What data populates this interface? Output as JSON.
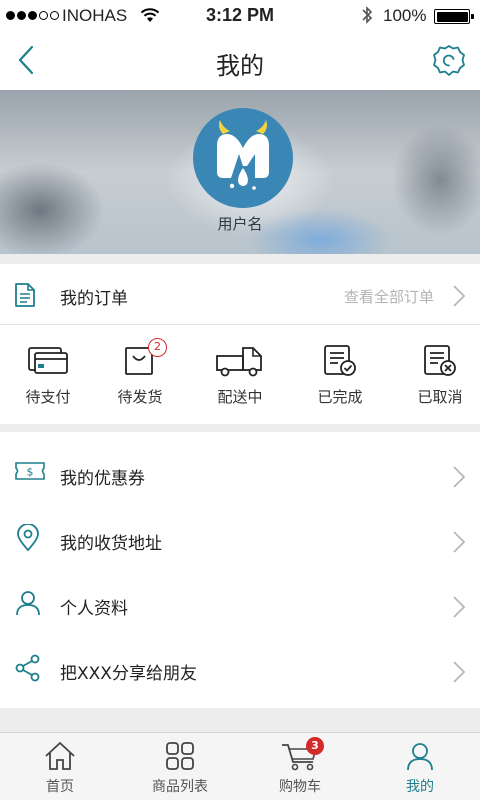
{
  "status_bar": {
    "carrier": "INOHAS",
    "time": "3:12 PM",
    "battery": "100%",
    "battery_level": 1.0
  },
  "nav": {
    "title": "我的",
    "back_icon": "chevron-left-icon",
    "settings_icon": "gear-icon"
  },
  "profile": {
    "username": "用户名"
  },
  "orders": {
    "title": "我的订单",
    "view_all": "查看全部订单",
    "statuses": [
      {
        "label": "待支付",
        "icon": "card-icon"
      },
      {
        "label": "待发货",
        "icon": "bag-icon",
        "badge": "2"
      },
      {
        "label": "配送中",
        "icon": "truck-icon"
      },
      {
        "label": "已完成",
        "icon": "doc-check-icon"
      },
      {
        "label": "已取消",
        "icon": "doc-cancel-icon"
      }
    ]
  },
  "menu": [
    {
      "label": "我的优惠券",
      "icon": "coupon-icon"
    },
    {
      "label": "我的收货地址",
      "icon": "location-pin-icon"
    },
    {
      "label": "个人资料",
      "icon": "person-icon"
    },
    {
      "label": "把XXX分享给朋友",
      "icon": "share-icon"
    }
  ],
  "tabs": [
    {
      "label": "首页",
      "icon": "home-icon"
    },
    {
      "label": "商品列表",
      "icon": "grid-icon"
    },
    {
      "label": "购物车",
      "icon": "cart-icon",
      "badge": "3"
    },
    {
      "label": "我的",
      "icon": "person-icon",
      "active": true
    }
  ],
  "colors": {
    "accent": "#1d7f8e",
    "avatar_bg": "#3a87b5",
    "badge": "#d42a2a"
  }
}
